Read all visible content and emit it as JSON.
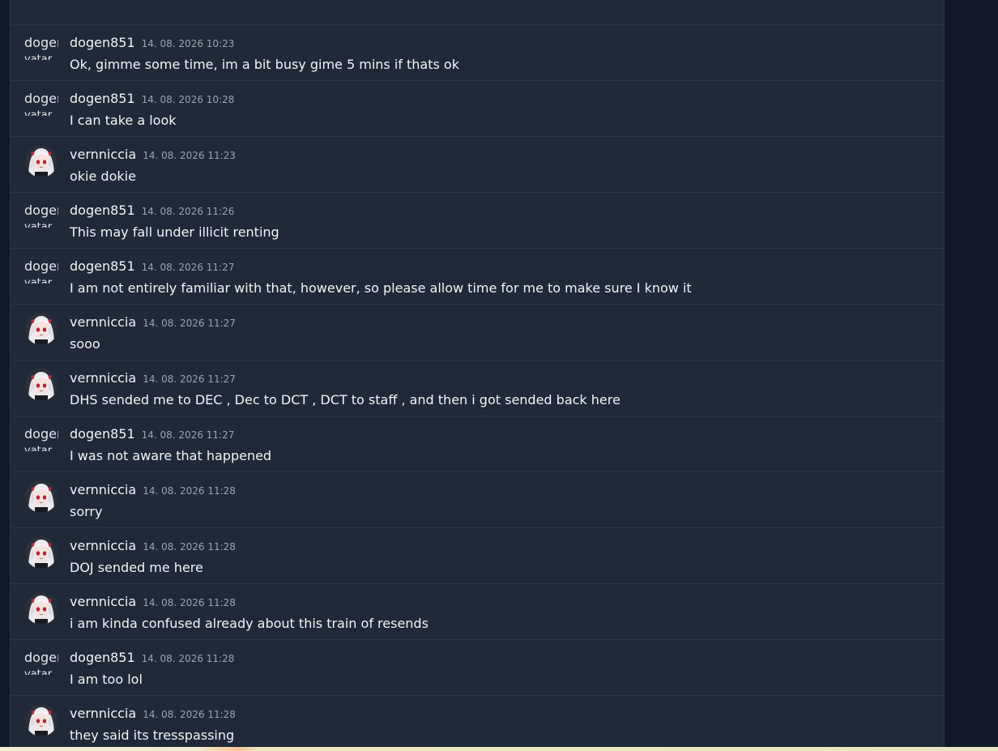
{
  "top_partial_text": "",
  "messages": [
    {
      "user": "dogen851",
      "time": "14. 08. 2026 10:23",
      "text": "Ok, gimme some time, im a bit busy gime 5 mins if thats ok",
      "avatar": "text",
      "alt1": "dogen",
      "alt2": "vatar"
    },
    {
      "user": "dogen851",
      "time": "14. 08. 2026 10:28",
      "text": "I can take a look",
      "avatar": "text",
      "alt1": "dogen",
      "alt2": "vatar"
    },
    {
      "user": "vernniccia",
      "time": "14. 08. 2026 11:23",
      "text": "okie dokie",
      "avatar": "image"
    },
    {
      "user": "dogen851",
      "time": "14. 08. 2026 11:26",
      "text": "This may fall under illicit renting",
      "avatar": "text",
      "alt1": "dogen",
      "alt2": "vatar"
    },
    {
      "user": "dogen851",
      "time": "14. 08. 2026 11:27",
      "text": "I am not entirely familiar with that, however, so please allow time for me to make sure I know it",
      "avatar": "text",
      "alt1": "dogen",
      "alt2": "vatar"
    },
    {
      "user": "vernniccia",
      "time": "14. 08. 2026 11:27",
      "text": "sooo",
      "avatar": "image"
    },
    {
      "user": "vernniccia",
      "time": "14. 08. 2026 11:27",
      "text": "DHS sended me to DEC , Dec to DCT , DCT to staff , and then i got sended back here",
      "avatar": "image"
    },
    {
      "user": "dogen851",
      "time": "14. 08. 2026 11:27",
      "text": "I was not aware that happened",
      "avatar": "text",
      "alt1": "dogen",
      "alt2": "vatar"
    },
    {
      "user": "vernniccia",
      "time": "14. 08. 2026 11:28",
      "text": "sorry",
      "avatar": "image"
    },
    {
      "user": "vernniccia",
      "time": "14. 08. 2026 11:28",
      "text": "DOJ sended me here",
      "avatar": "image"
    },
    {
      "user": "vernniccia",
      "time": "14. 08. 2026 11:28",
      "text": "i am kinda confused already about this train of resends",
      "avatar": "image"
    },
    {
      "user": "dogen851",
      "time": "14. 08. 2026 11:28",
      "text": "I am too lol",
      "avatar": "text",
      "alt1": "dogen",
      "alt2": "vatar"
    },
    {
      "user": "vernniccia",
      "time": "14. 08. 2026 11:28",
      "text": "they said its tresspassing",
      "avatar": "image"
    }
  ]
}
